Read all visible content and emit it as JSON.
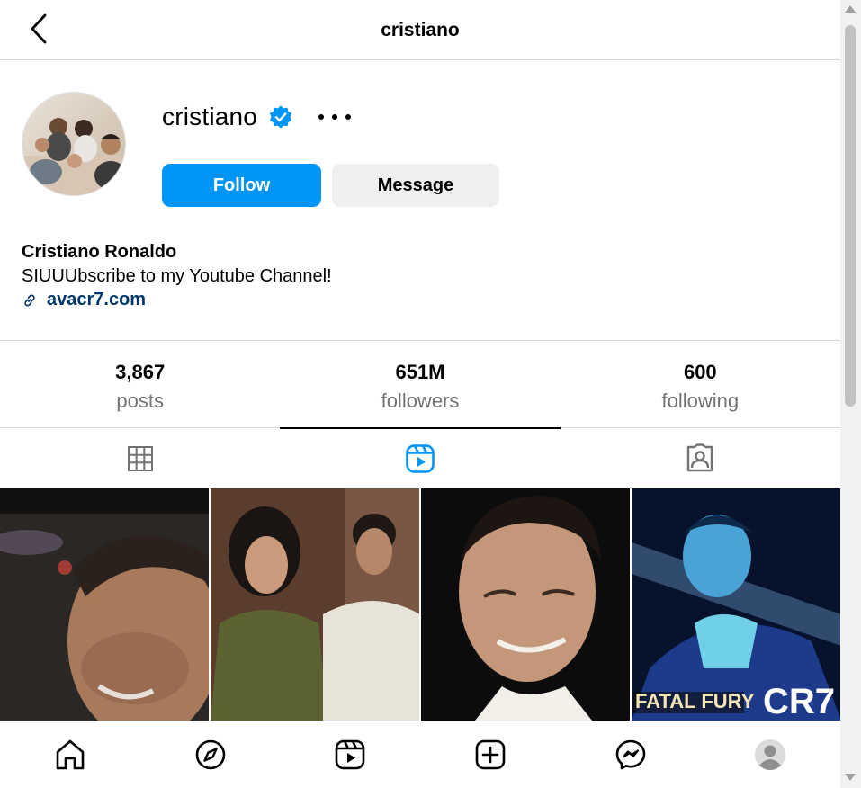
{
  "header": {
    "title": "cristiano"
  },
  "profile": {
    "username": "cristiano",
    "follow_label": "Follow",
    "message_label": "Message",
    "full_name": "Cristiano Ronaldo",
    "bio": "SIUUUbscribe to my Youtube Channel!",
    "link": "avacr7.com"
  },
  "stats": [
    {
      "value": "3,867",
      "label": "posts"
    },
    {
      "value": "651M",
      "label": "followers"
    },
    {
      "value": "600",
      "label": "following"
    }
  ],
  "tabs": [
    {
      "icon": "grid-icon",
      "active": false
    },
    {
      "icon": "reels-icon",
      "active": true
    },
    {
      "icon": "tagged-icon",
      "active": false
    }
  ],
  "posts": [
    {
      "image": "post-thumbnail-1"
    },
    {
      "image": "post-thumbnail-2"
    },
    {
      "image": "post-thumbnail-3"
    },
    {
      "image": "post-thumbnail-4",
      "overlay_text_1": "FATAL FURY",
      "overlay_text_2": "CR7"
    }
  ],
  "bottom_nav": [
    "home-icon",
    "explore-icon",
    "reels-icon",
    "create-icon",
    "messenger-icon",
    "profile-avatar"
  ],
  "colors": {
    "accent": "#0095f6",
    "link": "#00376b",
    "verified": "#0095f6",
    "muted": "#737373",
    "border": "#dbdbdb"
  }
}
